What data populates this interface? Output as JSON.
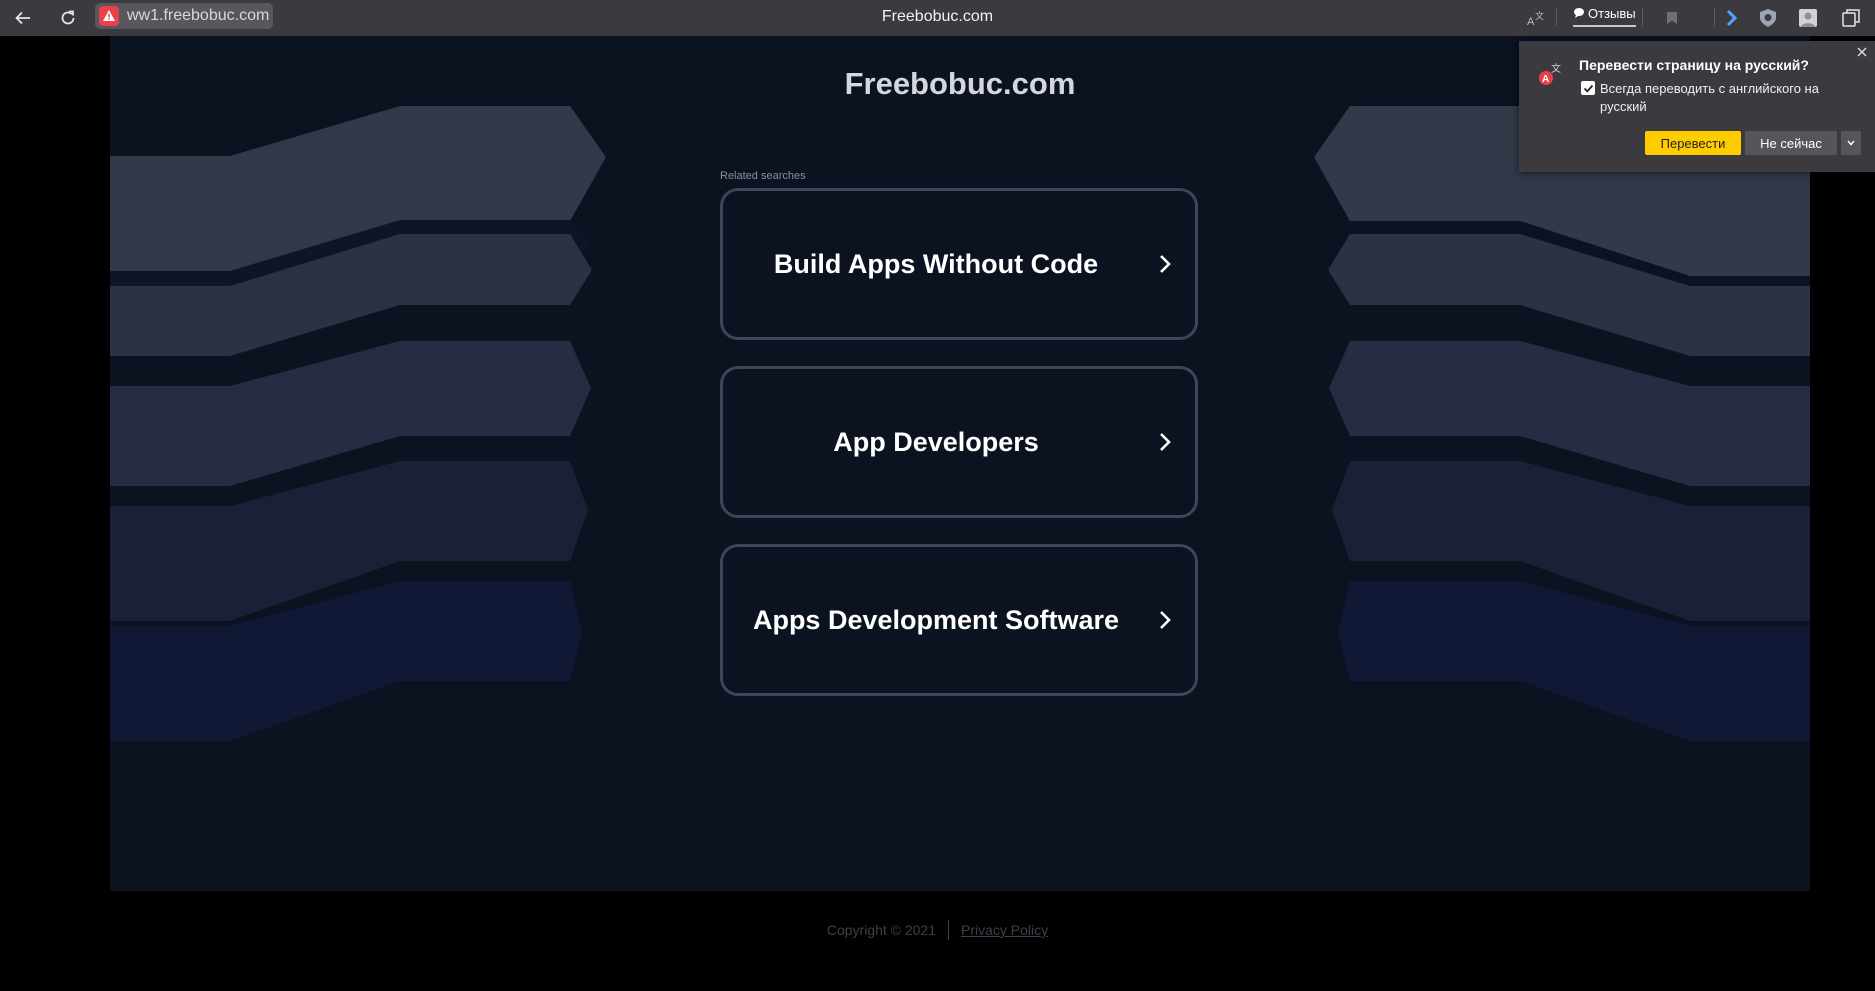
{
  "browser": {
    "address_url": "ww1.freebobuc.com",
    "tab_title": "Freebobuc.com",
    "reviews_label": "Отзывы",
    "icons": [
      "back-icon",
      "reload-icon",
      "warning-icon",
      "translate-icon",
      "reviews-icon",
      "bookmark-icon",
      "arrow-extension-icon",
      "shield-icon",
      "profile-icon",
      "tabs-collection-icon"
    ]
  },
  "page": {
    "site_title": "Freebobuc.com",
    "related_label": "Related searches",
    "links": [
      {
        "label": "Build Apps Without Code"
      },
      {
        "label": "App Developers"
      },
      {
        "label": "Apps Development Software"
      }
    ],
    "footer": {
      "copyright": "Copyright © 2021",
      "privacy": "Privacy Policy"
    }
  },
  "translate_popup": {
    "title": "Перевести страницу на русский?",
    "checkbox_label": "Всегда переводить с английского на русский",
    "checkbox_checked": true,
    "translate_button": "Перевести",
    "later_button": "Не сейчас"
  },
  "colors": {
    "page_bg": "#0b1220",
    "card_border": "#3e4556",
    "accent_yellow": "#ffcc00",
    "chrome_bg": "#3a3a3f"
  }
}
